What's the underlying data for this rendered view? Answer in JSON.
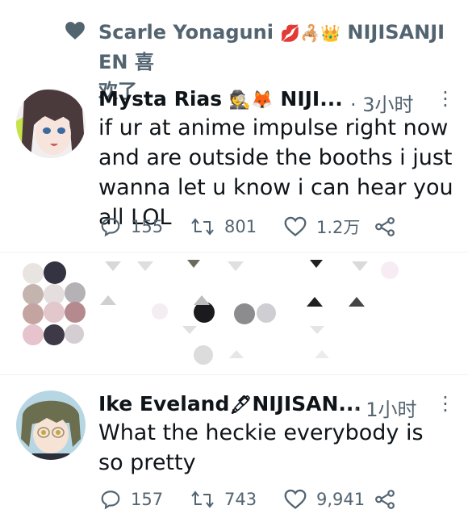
{
  "liked_by": {
    "icon": "heart-icon",
    "user": "Scarle Yonaguni",
    "emojis": "💋🦂👑",
    "suffix": "NIJISANJI EN 喜",
    "line2": "欢了"
  },
  "tweets": [
    {
      "name": "Mysta Rias",
      "name_emojis": "🕵🦊",
      "name_suffix": "NIJI...",
      "time": "· 3小时",
      "more": "⋮",
      "text": "if ur at anime impulse right now and are outside the booths i just wanna let u know i can hear you all LOL",
      "replies": "155",
      "retweets": "801",
      "likes": "1.2万"
    },
    {
      "name": "Ike Eveland",
      "name_emojis": "🖋",
      "name_suffix": "NIJISAN...",
      "time": "· 1小时",
      "more": "⋮",
      "text": "What the heckie everybody is so pretty",
      "replies": "157",
      "retweets": "743",
      "likes": "9,941"
    }
  ],
  "colors": {
    "secondary_text": "#536471",
    "primary_text": "#0f1419",
    "divider": "#eff3f4"
  }
}
